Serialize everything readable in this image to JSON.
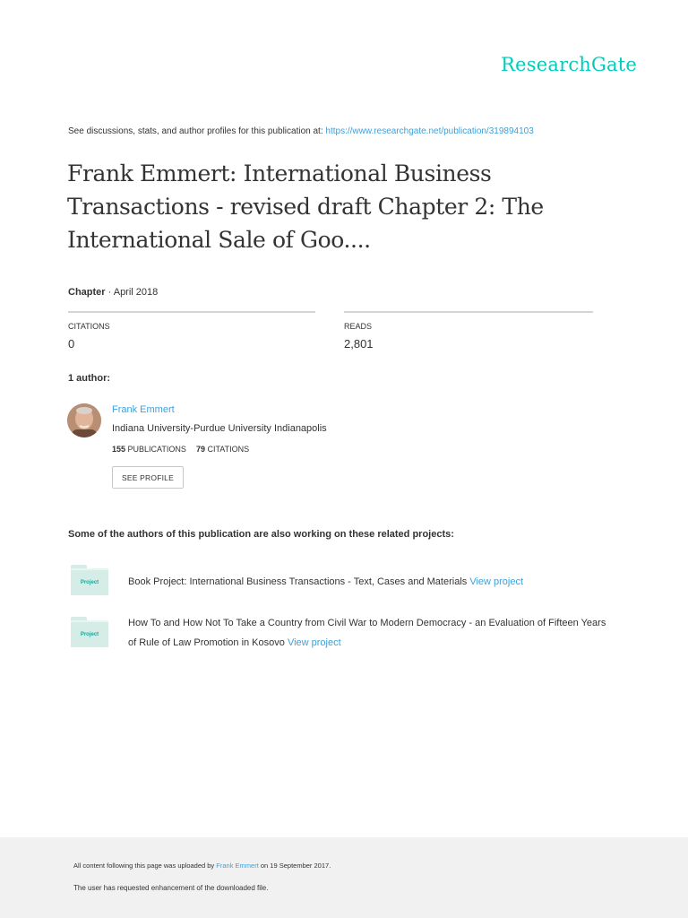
{
  "brand": "ResearchGate",
  "header": {
    "see_text": "See discussions, stats, and author profiles for this publication at: ",
    "url": "https://www.researchgate.net/publication/319894103"
  },
  "publication": {
    "title": "Frank Emmert: International Business Transactions - revised draft Chapter 2: The International Sale of Goo....",
    "type": "Chapter",
    "date": " · April 2018"
  },
  "stats": {
    "citations_label": "CITATIONS",
    "citations_value": "0",
    "reads_label": "READS",
    "reads_value": "2,801"
  },
  "authors": {
    "heading": "1 author:",
    "items": [
      {
        "name": "Frank Emmert",
        "institution": "Indiana University-Purdue University Indianapolis",
        "publications_count": "155",
        "publications_label": "PUBLICATIONS",
        "citations_count": "79",
        "citations_label": "CITATIONS",
        "profile_button": "SEE PROFILE"
      }
    ]
  },
  "projects": {
    "heading": "Some of the authors of this publication are also working on these related projects:",
    "icon_label": "Project",
    "items": [
      {
        "text": "Book Project: International Business Transactions - Text, Cases and Materials ",
        "link": "View project"
      },
      {
        "text": "How To and How Not To Take a Country from Civil War to Modern Democracy - an Evaluation of Fifteen Years of Rule of Law Promotion in Kosovo ",
        "link": "View project"
      }
    ]
  },
  "footer": {
    "upload_prefix": "All content following this page was uploaded by ",
    "uploader": "Frank Emmert",
    "upload_suffix": " on 19 September 2017.",
    "note": "The user has requested enhancement of the downloaded file."
  },
  "colors": {
    "brand": "#00ccbb",
    "link": "#40a0d8",
    "text": "#333333",
    "footer_bg": "#f1f1f1"
  }
}
